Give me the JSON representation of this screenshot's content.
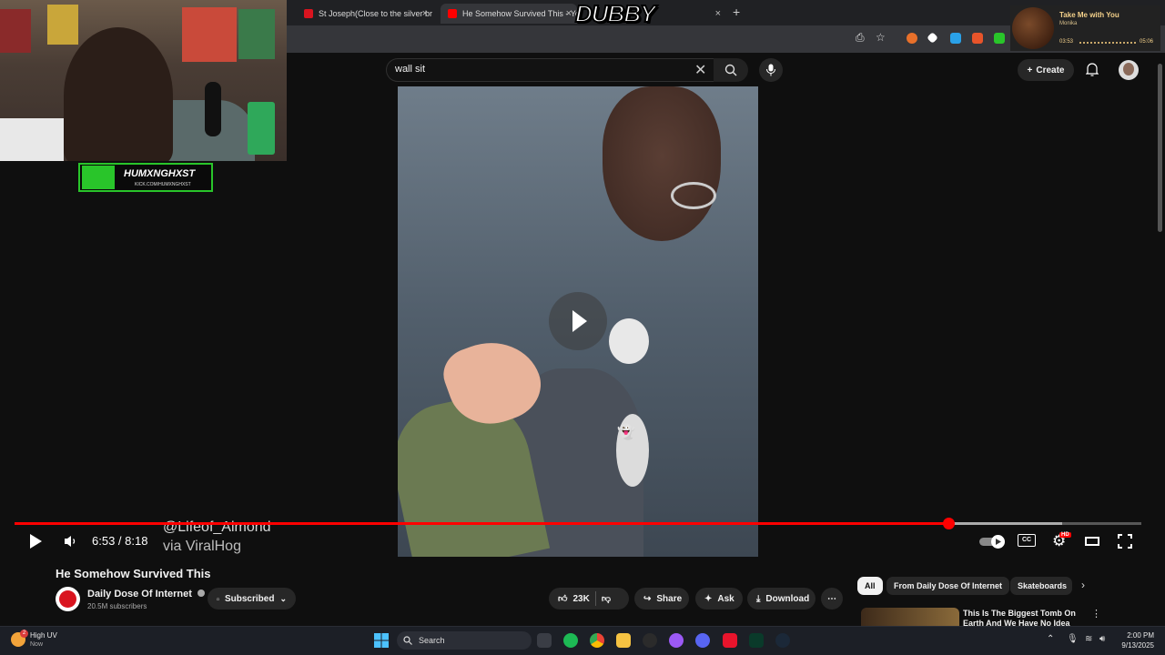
{
  "browser": {
    "tabs": [
      {
        "title": "St Joseph(Close to the silver br",
        "favicon_color": "#d9141f"
      },
      {
        "title": "He Somehow Survived This - Yo",
        "favicon_color": "#ff0000"
      }
    ],
    "overlay_logo": "DUBBY",
    "close_symbol": "×",
    "new_tab_symbol": "+"
  },
  "media_widget": {
    "song": "Take Me with You",
    "artist": "Monika",
    "elapsed": "03:53",
    "duration": "05:06"
  },
  "stream_overlay": {
    "badge_name": "HUMXNGHXST",
    "badge_url": "KICK.COM/HUMXNGHXST"
  },
  "youtube": {
    "search_value": "wall sit",
    "create_label": "Create",
    "video": {
      "watermark_handle": "@Lifeof_Almond",
      "watermark_via": "via ViralHog",
      "time_display": "6:53 / 8:18",
      "progress_fraction": 0.829,
      "buffered_fraction": 0.93
    },
    "title": "He Somehow Survived This",
    "channel": {
      "name": "Daily Dose Of Internet",
      "subscribers": "20.5M subscribers",
      "subscribe_label": "Subscribed"
    },
    "actions": {
      "likes": "23K",
      "share_label": "Share",
      "ask_label": "Ask",
      "download_label": "Download"
    },
    "chips": [
      "All",
      "From Daily Dose Of Internet",
      "Skateboards"
    ],
    "recommended": {
      "title": "This Is The Biggest Tomb On Earth And We Have No Idea"
    }
  },
  "taskbar": {
    "weather_title": "High UV",
    "weather_sub": "Now",
    "weather_badge": "2",
    "search_placeholder": "Search",
    "time": "2:00 PM",
    "date": "9/13/2025"
  },
  "colors": {
    "accent_red": "#ff0000",
    "kick_green": "#29c52a"
  }
}
